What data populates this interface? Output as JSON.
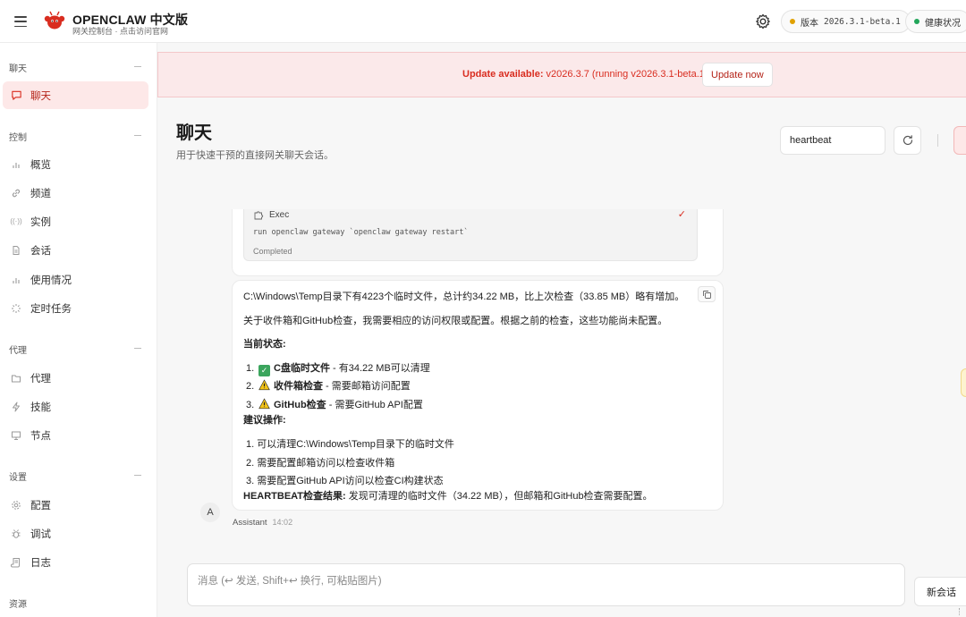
{
  "topbar": {
    "brand_title": "OPENCLAW 中文版",
    "brand_subtitle": "网关控制台 · 点击访问官网",
    "version_label": "版本",
    "version_value": "2026.3.1-beta.1",
    "health_label": "健康状况",
    "colors": {
      "version_dot": "#e0a100",
      "health_dot": "#22a65a",
      "accent": "#d92d20"
    }
  },
  "sidebar": {
    "groups": [
      {
        "label": "聊天",
        "items": [
          {
            "label": "聊天",
            "icon": "message-square-icon",
            "active": true
          }
        ]
      },
      {
        "label": "控制",
        "items": [
          {
            "label": "概览",
            "icon": "bar-chart-icon"
          },
          {
            "label": "频道",
            "icon": "link-icon"
          },
          {
            "label": "实例",
            "icon": "radio-icon"
          },
          {
            "label": "会话",
            "icon": "file-text-icon"
          },
          {
            "label": "使用情况",
            "icon": "bar-chart-icon"
          },
          {
            "label": "定时任务",
            "icon": "loader-icon"
          }
        ]
      },
      {
        "label": "代理",
        "items": [
          {
            "label": "代理",
            "icon": "folder-icon"
          },
          {
            "label": "技能",
            "icon": "zap-icon"
          },
          {
            "label": "节点",
            "icon": "monitor-icon"
          }
        ]
      },
      {
        "label": "设置",
        "items": [
          {
            "label": "配置",
            "icon": "settings-icon"
          },
          {
            "label": "调试",
            "icon": "bug-icon"
          },
          {
            "label": "日志",
            "icon": "scroll-icon"
          }
        ]
      },
      {
        "label": "资源",
        "items": []
      }
    ]
  },
  "banner": {
    "prefix": "Update available:",
    "text": " v2026.3.7 (running v2026.3.1-beta.1).",
    "button": "Update now"
  },
  "page": {
    "title": "聊天",
    "subtitle": "用于快速干预的直接网关聊天会话。",
    "session_value": "heartbeat"
  },
  "tool_card": {
    "name": "Exec",
    "command": "run openclaw gateway `openclaw gateway restart`",
    "status": "Completed"
  },
  "message": {
    "line1": "C:\\Windows\\Temp目录下有4223个临时文件，总计约34.22 MB，比上次检查（33.85 MB）略有增加。",
    "line2": "关于收件箱和GitHub检查，我需要相应的访问权限或配置。根据之前的检查，这些功能尚未配置。",
    "status_heading": "当前状态:",
    "status_items": [
      {
        "num": "1.",
        "emoji": "check-mark-icon",
        "title": "C盘临时文件",
        "desc": " - 有34.22 MB可以清理"
      },
      {
        "num": "2.",
        "emoji": "warning-icon",
        "title": "收件箱检查",
        "desc": " - 需要邮箱访问配置"
      },
      {
        "num": "3.",
        "emoji": "warning-icon",
        "title": "GitHub检查",
        "desc": " - 需要GitHub API配置"
      }
    ],
    "action_heading": "建议操作:",
    "action_items": [
      "1. 可以清理C:\\Windows\\Temp目录下的临时文件",
      "2. 需要配置邮箱访问以检查收件箱",
      "3. 需要配置GitHub API访问以检查CI构建状态"
    ],
    "result_label": "HEARTBEAT检查结果:",
    "result_text": " 发现可清理的临时文件（34.22 MB），但邮箱和GitHub检查需要配置。"
  },
  "sender": {
    "avatar": "A",
    "name": "Assistant",
    "time": "14:02"
  },
  "composer": {
    "placeholder": "消息 (↩ 发送, Shift+↩ 换行, 可粘贴图片)",
    "new_chat": "新会话"
  }
}
